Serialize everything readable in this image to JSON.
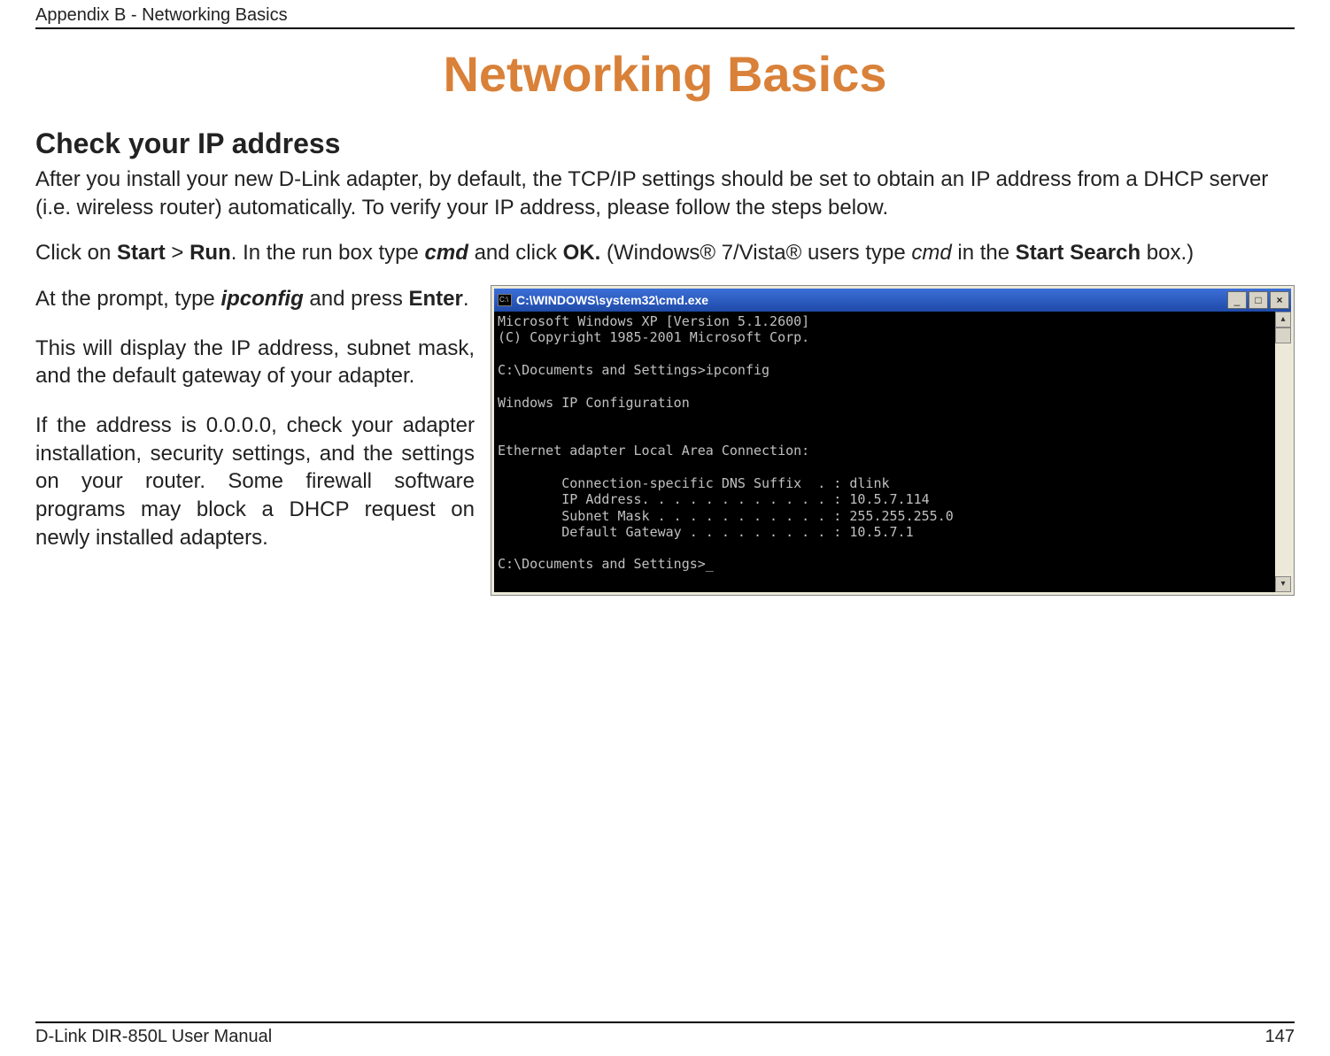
{
  "header": {
    "appendix": "Appendix B - Networking Basics"
  },
  "title": "Networking Basics",
  "section": {
    "heading": "Check your IP address"
  },
  "paras": {
    "intro": {
      "p1": "After you install your new D-Link adapter, by default, the TCP/IP settings should be set to obtain an IP address from a DHCP server (i.e. wireless router) automatically. To verify your IP address, please follow the steps below.",
      "p2a": "Click on ",
      "p2_start": "Start",
      "p2b": " > ",
      "p2_run": "Run",
      "p2c": ". In the run box type ",
      "p2_cmd": "cmd",
      "p2d": " and click ",
      "p2_ok": "OK.",
      "p2e": " (Windows® 7/Vista® users type ",
      "p2_cmd2": "cmd",
      "p2f": " in the ",
      "p2_search": "Start Search",
      "p2g": " box.)"
    },
    "left": {
      "l1a": "At the prompt, type ",
      "l1_ip": "ipconfig",
      "l1b": " and press ",
      "l1_enter": "Enter",
      "l1c": ".",
      "l2": "This will display the IP address, subnet mask, and the default gateway of your adapter.",
      "l3": "If the address is 0.0.0.0, check your adapter installation, security settings, and the settings on your router. Some firewall software programs may block a DHCP request on newly installed adapters."
    }
  },
  "cmd": {
    "titlebar_icon_text": "C:\\",
    "title": "C:\\WINDOWS\\system32\\cmd.exe",
    "min_label": "_",
    "max_label": "□",
    "close_label": "×",
    "sb_up": "▴",
    "sb_down": "▾",
    "output": "Microsoft Windows XP [Version 5.1.2600]\n(C) Copyright 1985-2001 Microsoft Corp.\n\nC:\\Documents and Settings>ipconfig\n\nWindows IP Configuration\n\n\nEthernet adapter Local Area Connection:\n\n        Connection-specific DNS Suffix  . : dlink\n        IP Address. . . . . . . . . . . . : 10.5.7.114\n        Subnet Mask . . . . . . . . . . . : 255.255.255.0\n        Default Gateway . . . . . . . . . : 10.5.7.1\n\nC:\\Documents and Settings>_"
  },
  "footer": {
    "manual": "D-Link DIR-850L User Manual",
    "page": "147"
  }
}
